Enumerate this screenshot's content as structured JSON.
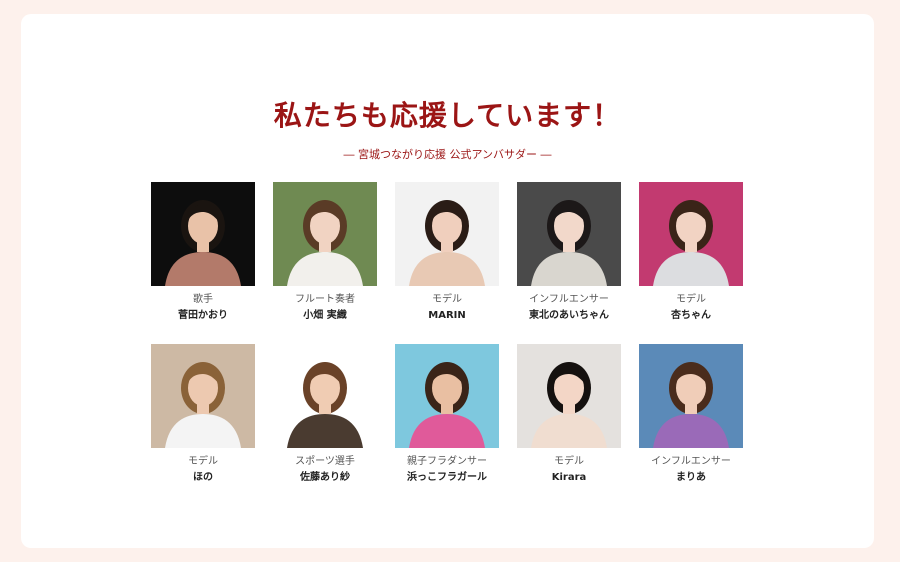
{
  "section": {
    "title": "私たちも応援しています！",
    "subtitle": "― 宮城つながり応援 公式アンバサダー ―"
  },
  "ambassadors": [
    {
      "role": "歌手",
      "name": "菅田かおり",
      "bg": "#0d0d0d",
      "hair": "#1a1410",
      "outfit": "#b37a6a",
      "skin": "#e9c2a8"
    },
    {
      "role": "フルート奏者",
      "name": "小畑 実織",
      "bg": "#6f8a52",
      "hair": "#5a3b26",
      "outfit": "#f2f0ec",
      "skin": "#f1d3c2"
    },
    {
      "role": "モデル",
      "name": "MARIN",
      "bg": "#f2f2f2",
      "hair": "#2a1c16",
      "outfit": "#e8c9b4",
      "skin": "#f0cfbd"
    },
    {
      "role": "インフルエンサー",
      "name": "東北のあいちゃん",
      "bg": "#4a4a4a",
      "hair": "#1c1818",
      "outfit": "#d9d6cf",
      "skin": "#f2d8ca"
    },
    {
      "role": "モデル",
      "name": "杏ちゃん",
      "bg": "#c23a70",
      "hair": "#3a2418",
      "outfit": "#dcdde0",
      "skin": "#f2d3c3"
    },
    {
      "role": "モデル",
      "name": "ほの",
      "bg": "#cdb9a4",
      "hair": "#8a6238",
      "outfit": "#f4f4f4",
      "skin": "#edc9b0"
    },
    {
      "role": "スポーツ選手",
      "name": "佐藤あり紗",
      "bg": "#ffffff",
      "hair": "#6a4228",
      "outfit": "#4a3b30",
      "skin": "#f0ccb3"
    },
    {
      "role": "親子フラダンサー",
      "name": "浜っこフラガール",
      "bg": "#7ec8de",
      "hair": "#3a2418",
      "outfit": "#e05a9a",
      "skin": "#e9bfa2"
    },
    {
      "role": "モデル",
      "name": "Kirara",
      "bg": "#e4e1de",
      "hair": "#15110f",
      "outfit": "#f0ddd0",
      "skin": "#f3d6c6"
    },
    {
      "role": "インフルエンサー",
      "name": "まりあ",
      "bg": "#5b8ab8",
      "hair": "#4a2c1c",
      "outfit": "#9a6ab8",
      "skin": "#f0cdb8"
    }
  ]
}
